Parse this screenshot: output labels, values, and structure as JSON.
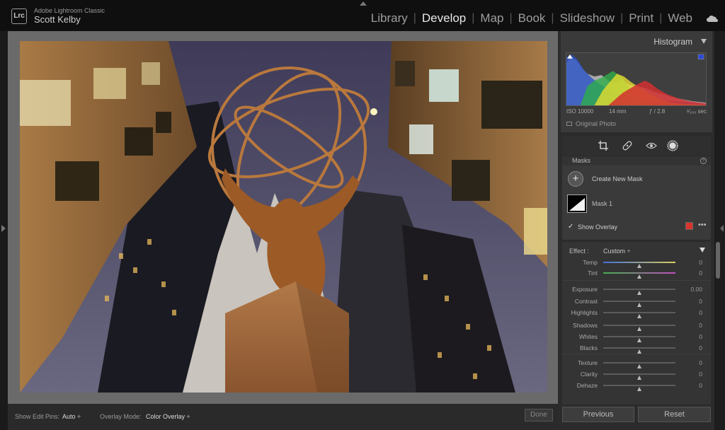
{
  "topbar": {
    "logo_text": "Lrc",
    "app_name": "Adobe Lightroom Classic",
    "user_name": "Scott Kelby",
    "modules": [
      {
        "label": "Library",
        "active": false
      },
      {
        "label": "Develop",
        "active": true
      },
      {
        "label": "Map",
        "active": false
      },
      {
        "label": "Book",
        "active": false
      },
      {
        "label": "Slideshow",
        "active": false
      },
      {
        "label": "Print",
        "active": false
      },
      {
        "label": "Web",
        "active": false
      }
    ],
    "separator": "|",
    "cloud_icon": "cloud-icon"
  },
  "histogram": {
    "title": "Histogram",
    "exif": {
      "iso": "ISO 10000",
      "focal": "14 mm",
      "aperture": "ƒ / 2.8",
      "shutter": "¹⁄₁₀₀ sec"
    },
    "original_photo_label": "Original Photo"
  },
  "tools": [
    "crop-icon",
    "heal-icon",
    "redeye-icon",
    "mask-icon"
  ],
  "masks": {
    "title": "Masks",
    "help": "?",
    "add_symbol": "+",
    "create_label": "Create New Mask",
    "mask_name": "Mask 1",
    "show_overlay_label": "Show Overlay",
    "check_mark": "✓",
    "more_symbol": "•••",
    "overlay_color": "#d9342b"
  },
  "adjustments": {
    "effect_label": "Effect :",
    "effect_value": "Custom ÷",
    "sliders": [
      {
        "label": "Temp",
        "value": "0",
        "pos": 0.5
      },
      {
        "label": "Tint",
        "value": "0",
        "pos": 0.5
      },
      {
        "label": "Exposure",
        "value": "0.00",
        "pos": 0.5
      },
      {
        "label": "Contrast",
        "value": "0",
        "pos": 0.5
      },
      {
        "label": "Highlights",
        "value": "0",
        "pos": 0.5
      },
      {
        "label": "Shadows",
        "value": "0",
        "pos": 0.5
      },
      {
        "label": "Whites",
        "value": "0",
        "pos": 0.5
      },
      {
        "label": "Blacks",
        "value": "0",
        "pos": 0.5
      },
      {
        "label": "Texture",
        "value": "0",
        "pos": 0.5
      },
      {
        "label": "Clarity",
        "value": "0",
        "pos": 0.5
      },
      {
        "label": "Dehaze",
        "value": "0",
        "pos": 0.5
      }
    ]
  },
  "toolbar": {
    "pins_label": "Show Edit Pins:",
    "pins_value": "Auto ÷",
    "overlay_mode_label": "Overlay Mode:",
    "overlay_mode_value": "Color Overlay ÷",
    "done_label": "Done"
  },
  "buttons": {
    "previous": "Previous",
    "reset": "Reset"
  }
}
